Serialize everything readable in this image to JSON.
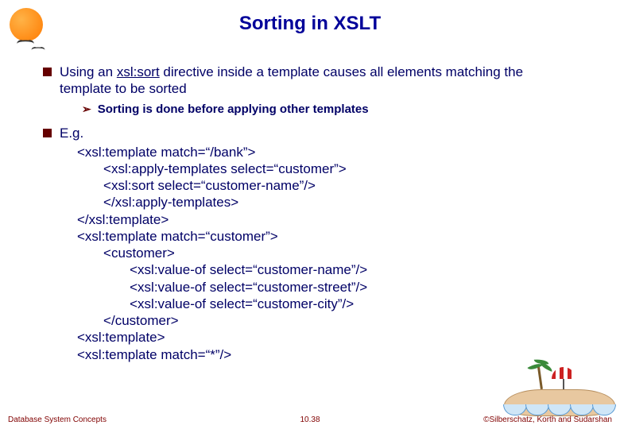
{
  "title": "Sorting in XSLT",
  "bullets": {
    "b1_text_pre": "Using an ",
    "b1_text_underline": "xsl:sort",
    "b1_text_post": " directive inside a template causes all elements matching the template to be sorted",
    "b1_sub": "Sorting is done before applying other templates",
    "b2_label": "E.g."
  },
  "code": {
    "l1": "<xsl:template match=“/bank”>",
    "l2": "       <xsl:apply-templates select=“customer”>",
    "l3": "       <xsl:sort select=“customer-name”/>",
    "l4": "       </xsl:apply-templates>",
    "l5": "</xsl:template>",
    "l6": "<xsl:template match=“customer”>",
    "l7": "       <customer>",
    "l8": "              <xsl:value-of select=“customer-name”/>",
    "l9": "              <xsl:value-of select=“customer-street”/>",
    "l10": "              <xsl:value-of select=“customer-city”/>",
    "l11": "       </customer>",
    "l12": "<xsl:template>",
    "l13": "<xsl:template match=“*”/>"
  },
  "footer": {
    "left": "Database System Concepts",
    "center": "10.38",
    "right": "©Silberschatz, Korth and Sudarshan"
  }
}
